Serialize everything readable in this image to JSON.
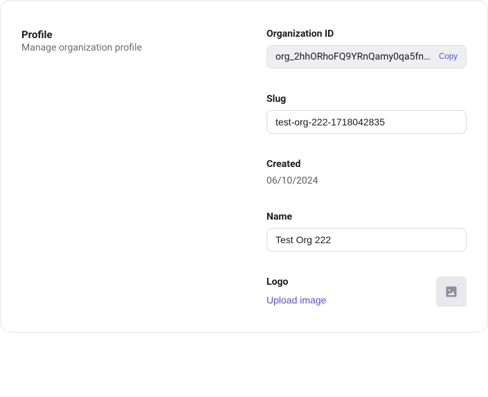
{
  "section": {
    "title": "Profile",
    "subtitle": "Manage organization profile"
  },
  "labels": {
    "org_id": "Organization ID",
    "slug": "Slug",
    "created": "Created",
    "name": "Name",
    "logo": "Logo"
  },
  "values": {
    "org_id_display": "org_2hhORhoFQ9YRnQamy0qa5fn…",
    "slug": "test-org-222-1718042835",
    "created": "06/10/2024",
    "name": "Test Org 222"
  },
  "actions": {
    "copy": "Copy",
    "upload_image": "Upload image"
  },
  "icons": {
    "logo_placeholder": "image-icon"
  }
}
